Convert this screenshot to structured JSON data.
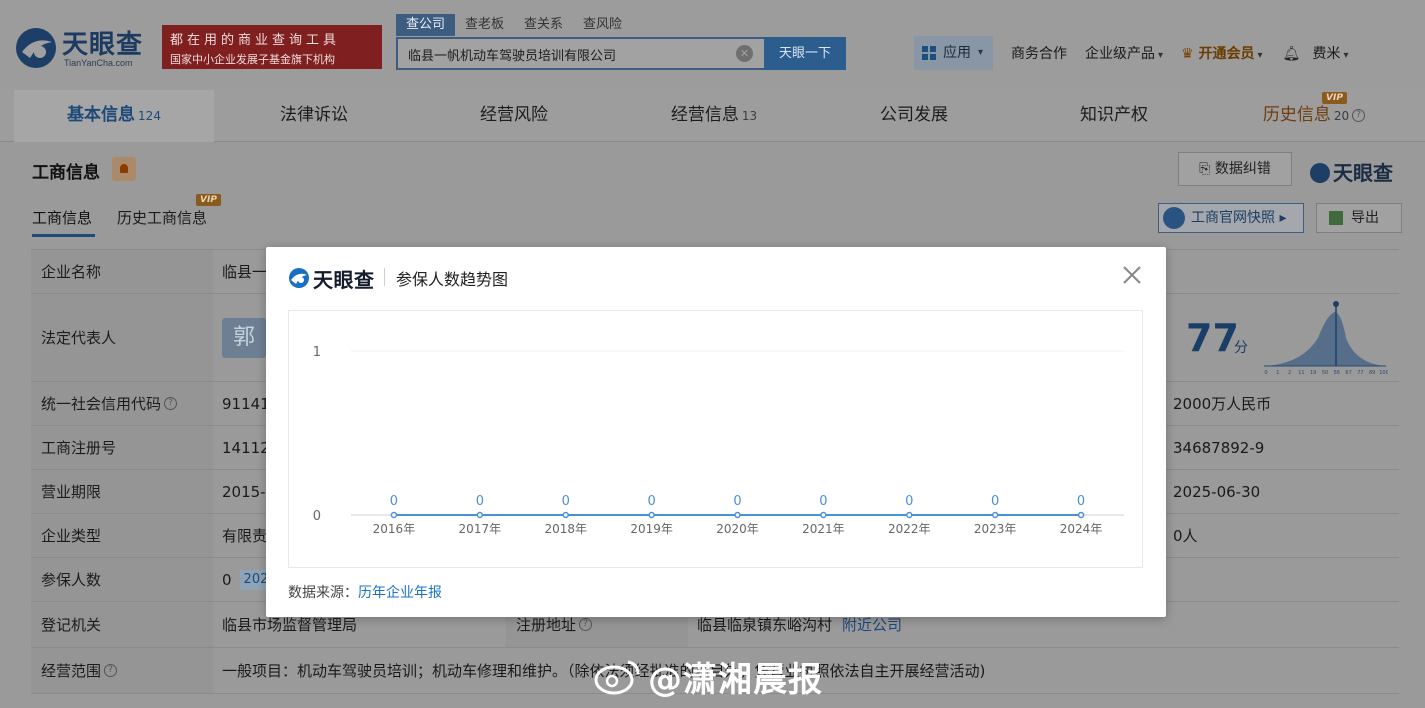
{
  "header": {
    "logo_text": "天眼查",
    "logo_sub": "TianYanCha.com",
    "slogan_line1": "都在用的商业查询工具",
    "slogan_line2": "国家中小企业发展子基金旗下机构",
    "search_tabs": [
      "查公司",
      "查老板",
      "查关系",
      "查风险"
    ],
    "search_value": "临县一帆机动车驾驶员培训有限公司",
    "search_button": "天眼一下",
    "nav": {
      "app": "应用",
      "business": "商务合作",
      "enterprise": "企业级产品",
      "vip": "开通会员",
      "user": "费米"
    }
  },
  "main_tabs": [
    {
      "label": "基本信息",
      "count": "124"
    },
    {
      "label": "法律诉讼",
      "count": ""
    },
    {
      "label": "经营风险",
      "count": ""
    },
    {
      "label": "经营信息",
      "count": "13"
    },
    {
      "label": "公司发展",
      "count": ""
    },
    {
      "label": "知识产权",
      "count": ""
    },
    {
      "label": "历史信息",
      "count": "20"
    }
  ],
  "vip_label": "VIP",
  "section": {
    "title": "工商信息",
    "correct_button": "数据纠错",
    "logo": "天眼查",
    "subtabs": [
      "工商信息",
      "历史工商信息"
    ],
    "snapshot_button": "工商官网快照",
    "export_button": "导出"
  },
  "table": {
    "rows": [
      {
        "label": "企业名称",
        "value": "临县一",
        "right": ""
      },
      {
        "label": "法定代表人",
        "value": "郭",
        "right": ""
      },
      {
        "label": "统一社会信用代码",
        "value": "91141",
        "right": "2000万人民币"
      },
      {
        "label": "工商注册号",
        "value": "14112",
        "right": "34687892-9"
      },
      {
        "label": "营业期限",
        "value": "2015-0",
        "right": "2025-06-30"
      },
      {
        "label": "企业类型",
        "value": "有限责",
        "right": "0人"
      },
      {
        "label": "参保人数",
        "value": "0",
        "tag": "202",
        "right": ""
      },
      {
        "label": "登记机关",
        "value": "临县市场监督管理局",
        "label2": "注册地址",
        "value2": "临县临泉镇东峪沟村",
        "link2": "附近公司",
        "right": ""
      },
      {
        "label": "经营范围",
        "value": "一般项目：机动车驾驶员培训；机动车修理和维护。（除依法须经批准的项目外，凭营业执照依法自主开展经营活动)",
        "right": ""
      }
    ],
    "score": "77",
    "score_unit": "分",
    "score_axis": [
      "0",
      "1",
      "2",
      "11",
      "19",
      "50",
      "56",
      "67",
      "77",
      "89",
      "100"
    ]
  },
  "watermark": "@潇湘晨报",
  "modal": {
    "logo_text": "天眼查",
    "title": "参保人数趋势图",
    "source_label": "数据来源：",
    "source_link": "历年企业年报",
    "chart_data": {
      "type": "line",
      "x": [
        "2016年",
        "2017年",
        "2018年",
        "2019年",
        "2020年",
        "2021年",
        "2022年",
        "2023年",
        "2024年"
      ],
      "values": [
        0,
        0,
        0,
        0,
        0,
        0,
        0,
        0,
        0
      ],
      "ylim": [
        0,
        1
      ],
      "yticks": [
        "0",
        "1"
      ],
      "line_color": "#4a90d9"
    }
  }
}
